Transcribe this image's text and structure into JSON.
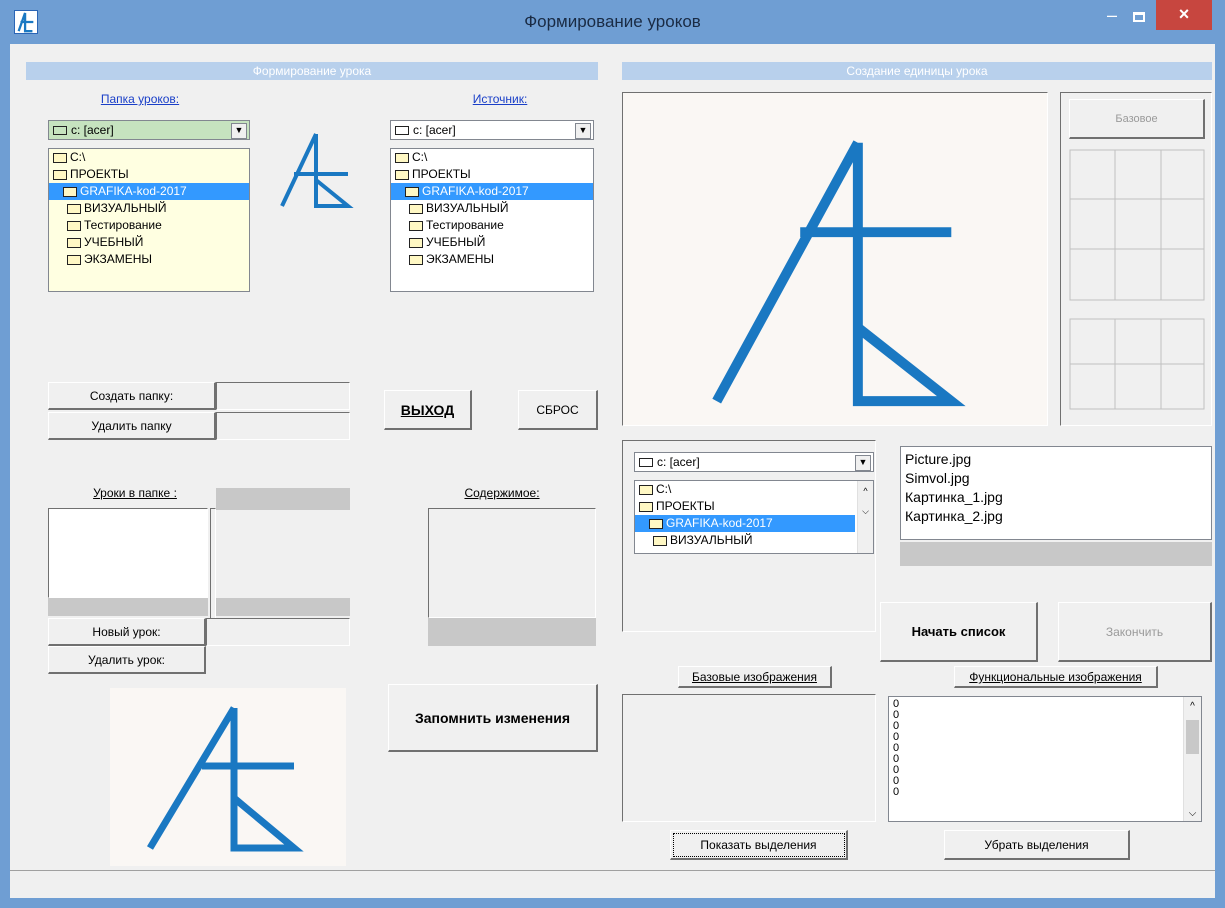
{
  "window": {
    "title": "Формирование уроков",
    "minimize": "–",
    "close": "×"
  },
  "left_panel": {
    "header": "Формирование урока",
    "lessons_folder_label": "Папка уроков:",
    "source_label": "Источник:",
    "drive_left": "c: [acer]",
    "drive_right": "c: [acer]",
    "tree_items": [
      "C:\\",
      "ПРОЕКТЫ",
      "GRAFIKA-kod-2017",
      "ВИЗУАЛЬНЫЙ",
      "Тестирование",
      "УЧЕБНЫЙ",
      "ЭКЗАМЕНЫ"
    ],
    "create_folder": "Создать папку:",
    "delete_folder": "Удалить папку",
    "exit": "ВЫХОД",
    "reset": "СБРОС",
    "lessons_in_folder": "Уроки в папке :",
    "contents": "Содержимое:",
    "new_lesson": "Новый урок:",
    "delete_lesson": "Удалить урок:",
    "save_changes": "Запомнить изменения"
  },
  "right_panel": {
    "header": "Создание единицы урока",
    "base_button": "Базовое",
    "drive": "c: [acer]",
    "tree_items": [
      "C:\\",
      "ПРОЕКТЫ",
      "GRAFIKA-kod-2017",
      "ВИЗУАЛЬНЫЙ"
    ],
    "files": [
      "Picture.jpg",
      "Simvol.jpg",
      "Картинка_1.jpg",
      "Картинка_2.jpg"
    ],
    "start_list": "Начать список",
    "finish": "Закончить",
    "base_images": "Базовые изображения",
    "functional_images": "Функциональные изображения",
    "numbers": [
      "0",
      "0",
      "0",
      "0",
      "0",
      "0",
      "0",
      "0",
      "0"
    ],
    "show_selection": "Показать выделения",
    "remove_selection": "Убрать выделения"
  },
  "colors": {
    "logo_blue": "#1a78c2",
    "title_bar": "#6f9ed3",
    "selection": "#3399ff"
  },
  "icons": [
    "app-logo-icon",
    "folder-icon",
    "drive-icon",
    "chevron-down-icon",
    "close-icon"
  ]
}
